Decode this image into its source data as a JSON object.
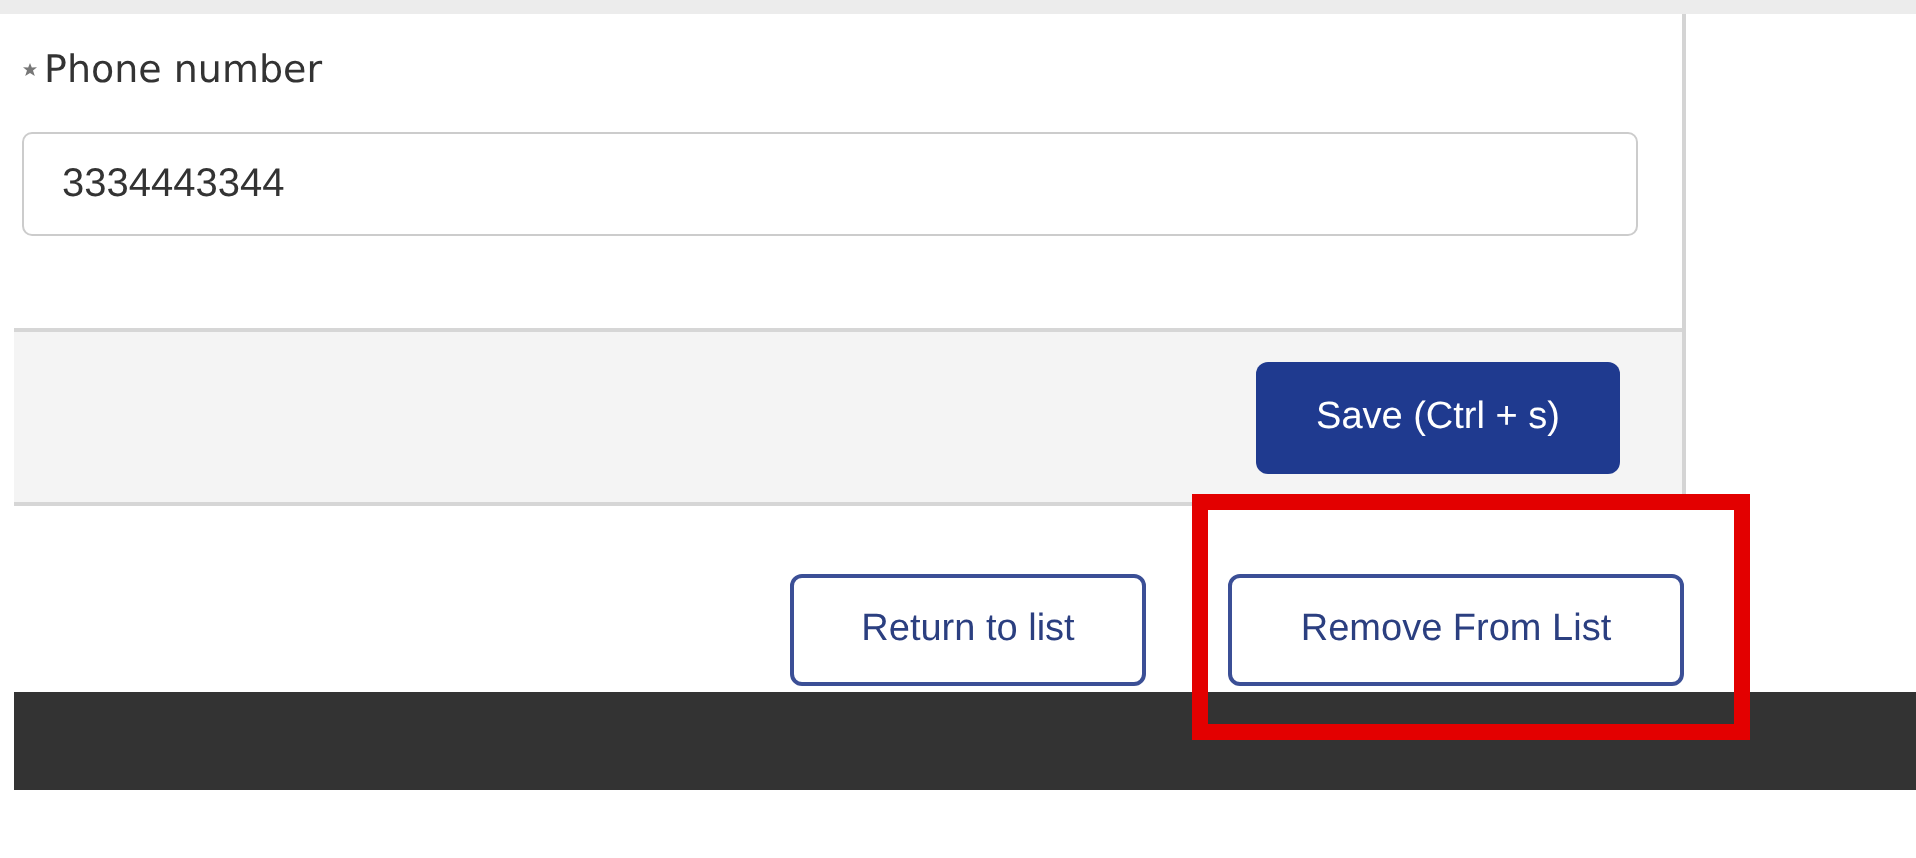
{
  "field": {
    "label": "Phone number",
    "required": true,
    "value": "3334443344"
  },
  "save_button": {
    "label": "Save (Ctrl + s)"
  },
  "actions": [
    {
      "label": "Return to list",
      "highlighted": false
    },
    {
      "label": "Remove From List",
      "highlighted": true
    }
  ]
}
